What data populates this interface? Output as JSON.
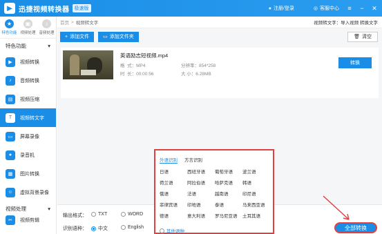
{
  "titlebar": {
    "app_title": "迅捷视频转换器",
    "badge": "极速版",
    "user": "注册/登录",
    "service": "客服中心"
  },
  "top_icons": [
    {
      "label": "特色功能"
    },
    {
      "label": "视频处理"
    },
    {
      "label": "音频处理"
    }
  ],
  "sidebar": {
    "section1": "特色功能",
    "items": [
      {
        "label": "视频转换"
      },
      {
        "label": "音频转换"
      },
      {
        "label": "视频压缩"
      },
      {
        "label": "视频转文字"
      },
      {
        "label": "屏幕录像"
      },
      {
        "label": "录音机"
      },
      {
        "label": "图片转换"
      },
      {
        "label": "虚拟背景录像"
      }
    ],
    "section2": "视频处理",
    "last_item": "视频剪辑"
  },
  "breadcrumb": {
    "home": "首页",
    "current": "视频转文字",
    "right": "视频转文字：导入视频 转换文字"
  },
  "actions": {
    "add_file": "添加文件",
    "add_folder": "添加文件夹",
    "clear": "清空"
  },
  "file": {
    "name": "英语励志短视频.mp4",
    "format_label": "格",
    "format_value": "式：MP4",
    "duration_label": "时",
    "duration_value": "长：00:00:56",
    "resolution": "分辨率：854*258",
    "size": "大  小：6.28MB",
    "convert": "转换"
  },
  "output": {
    "label": "输出格式：",
    "opt1": "TXT",
    "opt2": "WORD"
  },
  "recognition": {
    "label": "识别语种：",
    "opt1": "中文",
    "opt2": "English",
    "more": "其他语种"
  },
  "lang_popup": {
    "tabs": [
      "外语识别",
      "方言识别"
    ],
    "languages": [
      "日语",
      "西班牙语",
      "葡萄牙语",
      "波兰语",
      "荷兰语",
      "阿拉伯语",
      "哈萨克语",
      "韩语",
      "俄语",
      "法语",
      "越南语",
      "印尼语",
      "菲律宾语",
      "印地语",
      "泰语",
      "马来西亚语",
      "德语",
      "意大利语",
      "罗马尼亚语",
      "土耳其语"
    ]
  },
  "convert_all": "全部转换"
}
